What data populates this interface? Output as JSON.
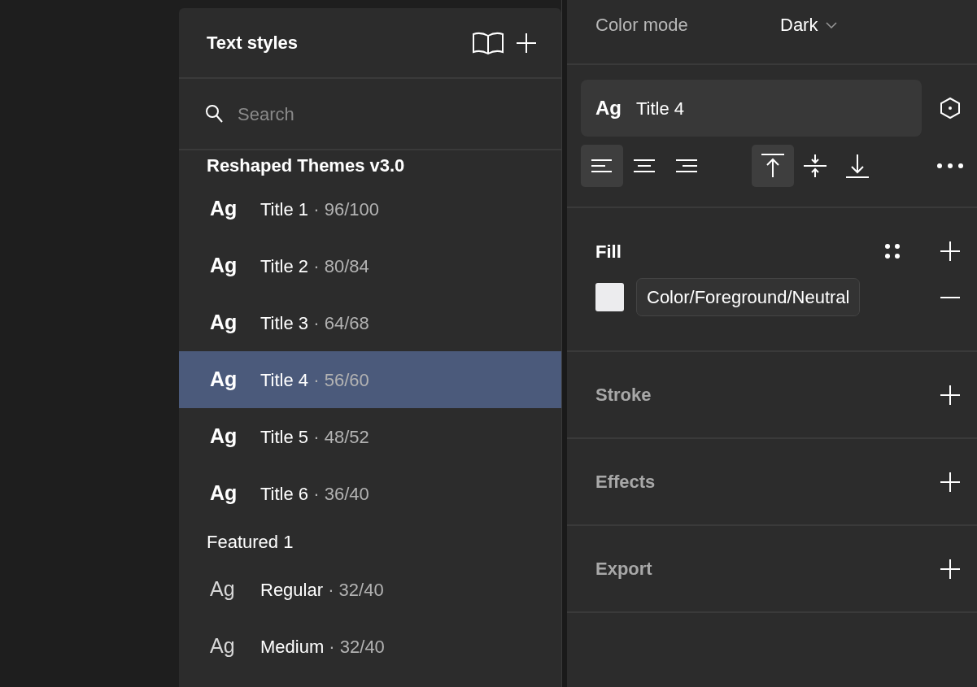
{
  "text_styles": {
    "title": "Text styles",
    "search": {
      "placeholder": "Search"
    },
    "groups": [
      {
        "name": "Reshaped Themes v3.0",
        "kind": "bold",
        "items": [
          {
            "sample": "Ag",
            "name": "Title 1",
            "size": "· 96/100",
            "selected": false
          },
          {
            "sample": "Ag",
            "name": "Title 2",
            "size": "· 80/84",
            "selected": false
          },
          {
            "sample": "Ag",
            "name": "Title 3",
            "size": "· 64/68",
            "selected": false
          },
          {
            "sample": "Ag",
            "name": "Title 4",
            "size": "· 56/60",
            "selected": true
          },
          {
            "sample": "Ag",
            "name": "Title 5",
            "size": "· 48/52",
            "selected": false
          },
          {
            "sample": "Ag",
            "name": "Title 6",
            "size": "· 36/40",
            "selected": false
          }
        ]
      },
      {
        "name": "Featured 1",
        "kind": "regular",
        "items": [
          {
            "sample": "Ag",
            "name": "Regular",
            "size": "· 32/40",
            "selected": false
          },
          {
            "sample": "Ag",
            "name": "Medium",
            "size": "· 32/40",
            "selected": false
          }
        ]
      }
    ]
  },
  "properties": {
    "color_mode": {
      "label": "Color mode",
      "value": "Dark"
    },
    "style": {
      "sample": "Ag",
      "name": "Title 4"
    },
    "horizontal_align": [
      {
        "kind": "left",
        "selected": true
      },
      {
        "kind": "center",
        "selected": false
      },
      {
        "kind": "right",
        "selected": false
      }
    ],
    "vertical_align": [
      {
        "kind": "top",
        "selected": true
      },
      {
        "kind": "middle",
        "selected": false
      },
      {
        "kind": "bottom",
        "selected": false
      }
    ],
    "sections": [
      {
        "title": "Fill",
        "active": true,
        "fills": [
          {
            "color": "#ececee",
            "name": "Color/Foreground/Neutral"
          }
        ]
      },
      {
        "title": "Stroke",
        "active": false
      },
      {
        "title": "Effects",
        "active": false
      },
      {
        "title": "Export",
        "active": false
      }
    ]
  }
}
